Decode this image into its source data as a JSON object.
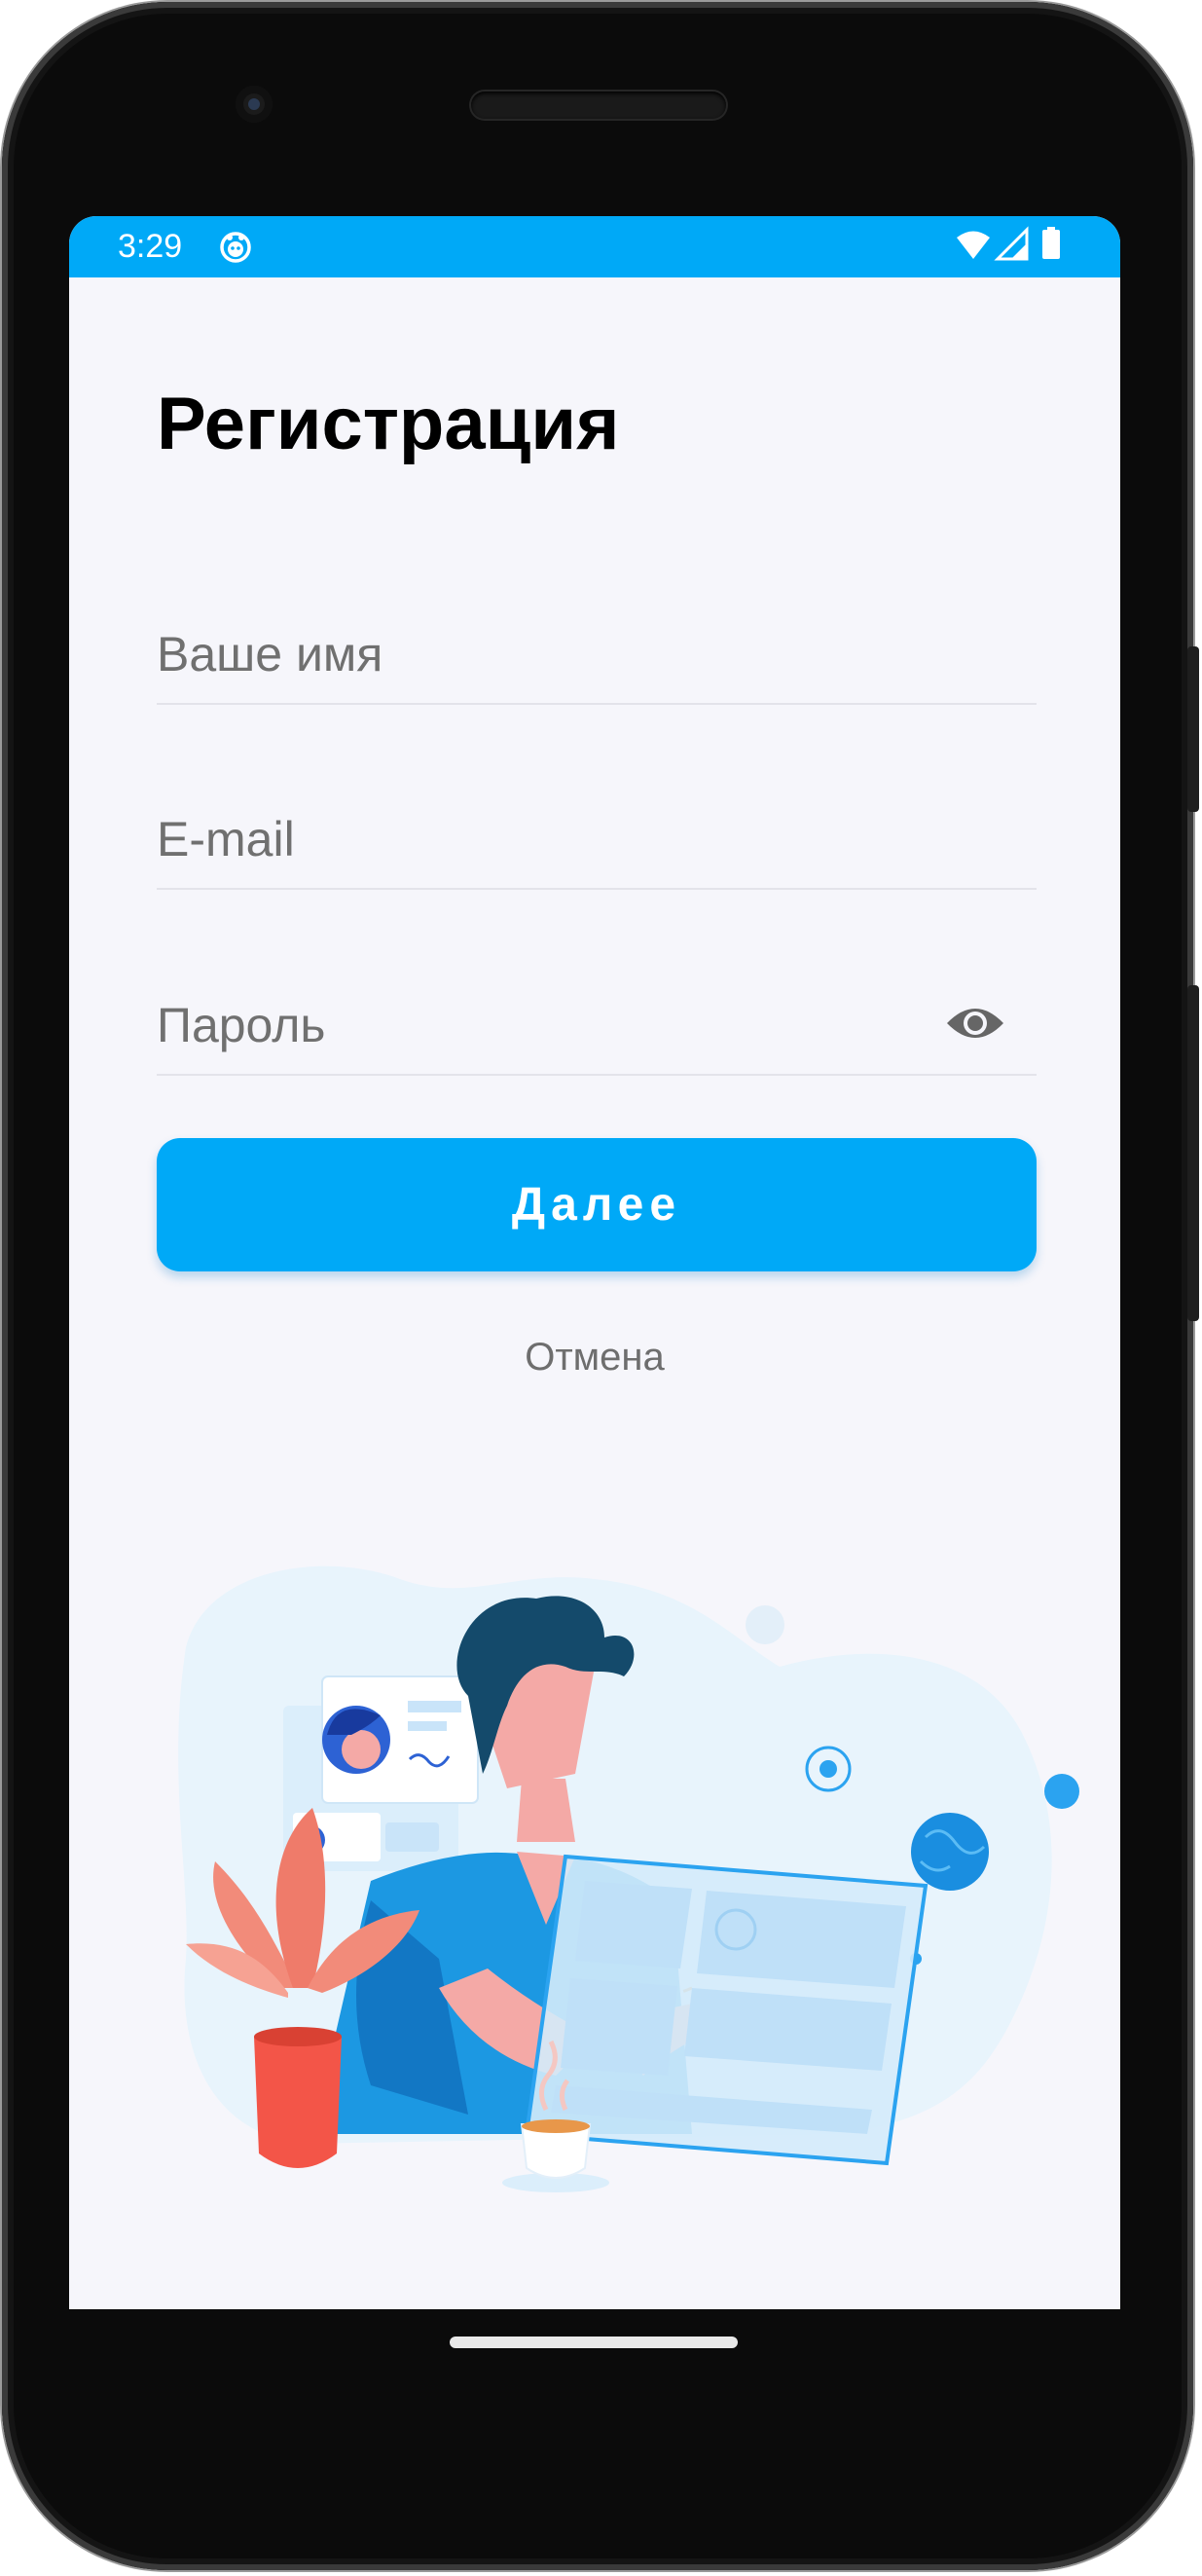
{
  "status_bar": {
    "time": "3:29",
    "background": "#00a9f7",
    "icons": [
      "app-notification-icon",
      "wifi-icon",
      "cellular-signal-icon",
      "battery-icon"
    ]
  },
  "screen": {
    "title": "Регистрация",
    "fields": {
      "name": {
        "placeholder": "Ваше имя",
        "value": ""
      },
      "email": {
        "placeholder": "E-mail",
        "value": ""
      },
      "password": {
        "placeholder": "Пароль",
        "value": "",
        "toggle_icon": "eye-icon"
      }
    },
    "next_button": "Далее",
    "cancel_link": "Отмена",
    "illustration_icon": "man-with-tablet-illustration"
  },
  "colors": {
    "accent": "#00a9f7",
    "background": "#f6f6fb",
    "placeholder": "#707070",
    "divider": "#e3e3ea"
  }
}
